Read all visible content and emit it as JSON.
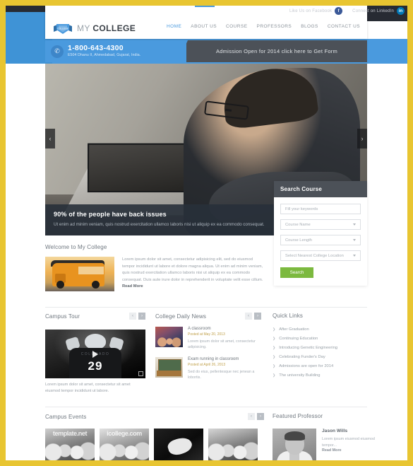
{
  "topbar": {
    "facebook": {
      "label": "Like Us on Facebook",
      "icon": "facebook-icon",
      "glyph": "f",
      "color": "#3b5998"
    },
    "linkedin": {
      "label": "Connect on LinkedIn",
      "icon": "linkedin-icon",
      "glyph": "in",
      "color": "#0077b5"
    }
  },
  "header": {
    "logo_text_light": "MY ",
    "logo_text_bold": "COLLEGE",
    "logo_badge": "MY COLLEGE",
    "nav": [
      {
        "label": "HOME",
        "active": true
      },
      {
        "label": "ABOUT US",
        "active": false
      },
      {
        "label": "COURSE",
        "active": false
      },
      {
        "label": "PROFESSORS",
        "active": false
      },
      {
        "label": "BLOGS",
        "active": false
      },
      {
        "label": "CONTACT US",
        "active": false
      }
    ]
  },
  "contactbar": {
    "phone": "1-800-643-4300",
    "address": "E504 Dhanu II, Ahmedabad, Gujarat, India.",
    "phone_icon": "phone-icon",
    "admission": "Admission Open for 2014 click here to Get Form"
  },
  "hero": {
    "title": "90% of the people have back issues",
    "text": "Ut enim ad minim veniam, quis nostrud exercitation ullamco laboris nisi ut aliquip ex ea commodo consequat.",
    "prev": "‹",
    "next": "›"
  },
  "search_course": {
    "title": "Search Course",
    "keyword_placeholder": "Fill your keywords",
    "course_name": "Course Name",
    "course_length": "Course Length",
    "location": "Select Nearest College Location",
    "button": "Search",
    "button_color": "#7cb93f"
  },
  "welcome": {
    "title": "Welcome to My College",
    "text": "Lorem ipsum dolor sit amet, consectetur adipisicing elit, sed do eiusmod tempor incididunt ut labore et dolore magna aliqua. Ut enim ad minim veniam, quis nostrud exercitation ullamco laboris nisi ut aliquip ex ea commodo consequat. Duis aute irure dolor in reprehenderit in voluptate velit esse cillum. ",
    "read_more": "Read More"
  },
  "campus_tour": {
    "title": "Campus Tour",
    "video_number": "29",
    "video_word": "COLORADO",
    "play_icon": "play-icon",
    "fullscreen_icon": "fullscreen-icon",
    "text": "Lorem ipsum dolor sit amet, consectetur sit amet eiusmod tempor incididunt ut labore.",
    "prev": "‹",
    "next": "›"
  },
  "news": {
    "title": "College Daily News",
    "prev": "‹",
    "next": "›",
    "items": [
      {
        "title": "A classroom",
        "date": "Posted at May 20, 2013",
        "excerpt": "Lorem ipsum dolor sit amet, consectetur adipisicing."
      },
      {
        "title": "Exam running in classroom",
        "date": "Posted at April 26, 2013",
        "excerpt": "Sed do eius, pellentesque nec jenean a lobortis."
      }
    ]
  },
  "quick_links": {
    "title": "Quick Links",
    "arrow_icon": "chevron-right-icon",
    "items": [
      {
        "label": "After Graduation"
      },
      {
        "label": "Continuing Education"
      },
      {
        "label": "Introducing Genetic Engineering"
      },
      {
        "label": "Celebrating Funder's Day"
      },
      {
        "label": "Admissions are open for 2014"
      },
      {
        "label": "The university Building"
      }
    ]
  },
  "campus_events": {
    "title": "Campus Events",
    "prev": "‹",
    "next": "›",
    "items": [
      {
        "caption": "template.net"
      },
      {
        "caption": "icollege.com"
      },
      {
        "caption": ""
      },
      {
        "caption": ""
      }
    ]
  },
  "featured_professor": {
    "title": "Featured Professor",
    "name": "Jason Wills",
    "text": "Lorem ipsum eiusmod eiusmod tempor...",
    "read_more": "Read More"
  }
}
